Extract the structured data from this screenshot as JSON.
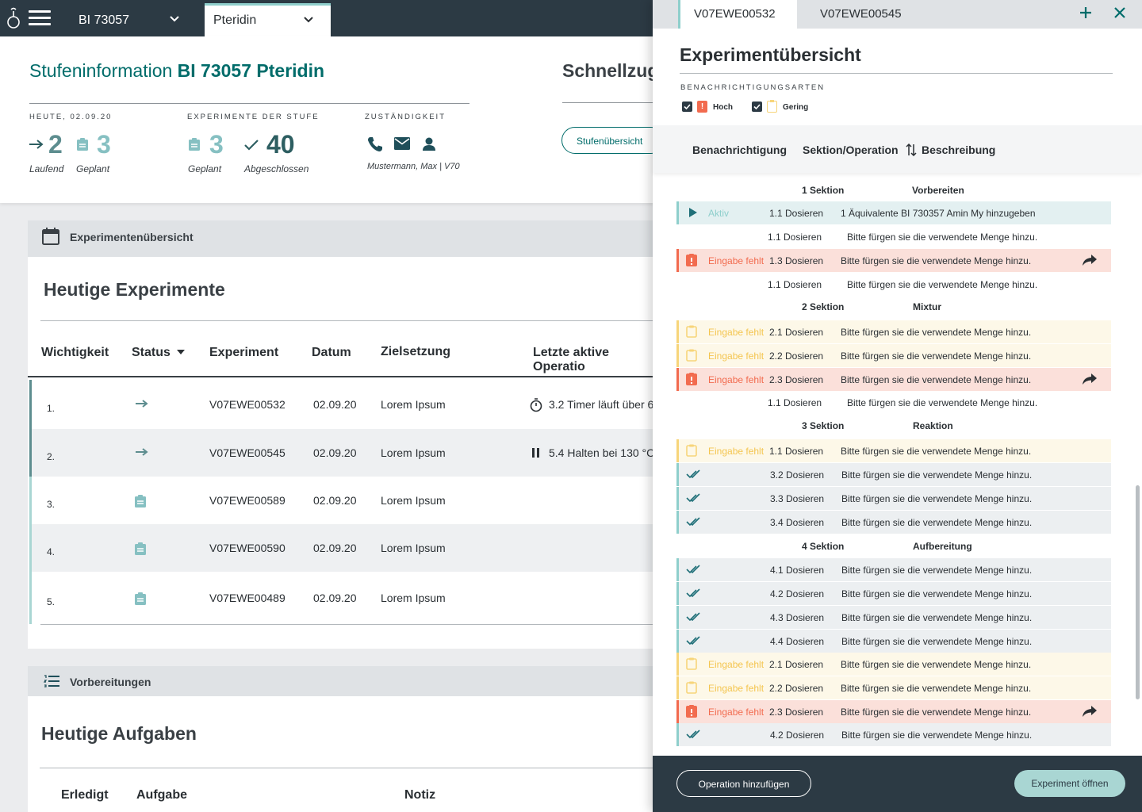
{
  "topbar": {
    "project_select": "BI 73057",
    "compound_select": "Pteridin"
  },
  "stage_info": {
    "title_prefix": "Stufeninformation",
    "title_bold": "BI 73057 Pteridin",
    "today_caption": "HEUTE, 02.09.20",
    "today_running": "2",
    "today_running_label": "Laufend",
    "today_planned": "3",
    "today_planned_label": "Geplant",
    "stage_caption": "EXPERIMENTE DER STUFE",
    "stage_planned": "3",
    "stage_planned_label": "Geplant",
    "stage_completed": "40",
    "stage_completed_label": "Abgeschlossen",
    "resp_caption": "ZUSTÄNDIGKEIT",
    "resp_person": "Mustermann, Max | V70",
    "quick_title": "Schnellzug",
    "quick_button": "Stufenübersicht"
  },
  "experiments": {
    "section_label": "Experimentenübersicht",
    "title": "Heutige Experimente",
    "columns": [
      "Wichtigkeit",
      "Status",
      "Experiment",
      "Datum",
      "Zielsetzung",
      "Letzte aktive Operatio"
    ],
    "rows": [
      {
        "idx": "1.",
        "status": "running",
        "experiment": "V07EWE00532",
        "date": "02.09.20",
        "goal": "Lorem Ipsum",
        "last_op": "3.2 Timer läuft über 6",
        "last_icon": "timer-icon"
      },
      {
        "idx": "2.",
        "status": "running",
        "experiment": "V07EWE00545",
        "date": "02.09.20",
        "goal": "Lorem Ipsum",
        "last_op": "5.4 Halten bei 130 °C",
        "last_icon": "pause-icon"
      },
      {
        "idx": "3.",
        "status": "planned",
        "experiment": "V07EWE00589",
        "date": "02.09.20",
        "goal": "Lorem Ipsum",
        "last_op": "",
        "last_icon": ""
      },
      {
        "idx": "4.",
        "status": "planned",
        "experiment": "V07EWE00590",
        "date": "02.09.20",
        "goal": "Lorem Ipsum",
        "last_op": "",
        "last_icon": ""
      },
      {
        "idx": "5.",
        "status": "planned",
        "experiment": "V07EWE00489",
        "date": "02.09.20",
        "goal": "Lorem Ipsum",
        "last_op": "",
        "last_icon": ""
      }
    ]
  },
  "preparations": {
    "section_label": "Vorbereitungen",
    "title": "Heutige Aufgaben",
    "columns": [
      "Erledigt",
      "Aufgabe",
      "Notiz"
    ]
  },
  "drawer": {
    "tabs": [
      "V07EWE00532",
      "V07EWE00545"
    ],
    "title": "Experimentübersicht",
    "notif_caption": "BENACHRICHTIGUNGSARTEN",
    "notif_high": "Hoch",
    "notif_low": "Geringe",
    "notif_low_short": "Gering",
    "columns": [
      "Benachrichtigung",
      "Sektion/Operation",
      "Beschreibung"
    ],
    "footer_add": "Operation hinzufügen",
    "footer_open": "Experiment öffnen",
    "colors": {
      "active_bg": "#e3f0f1",
      "high_bg": "#fbe0da",
      "low_bg": "#fdf8e8",
      "done_bg": "#eceff1",
      "accent": "#006c6a"
    },
    "sections": [
      {
        "name": "1 Sektion",
        "title": "Vorbereiten",
        "ops": [
          {
            "type": "active",
            "status": "Aktiv",
            "op": "1.1 Dosieren",
            "desc": "1 Äquivalente BI 730357 Amin My hinzugeben"
          },
          {
            "type": "plain",
            "status": "",
            "op": "1.1 Dosieren",
            "desc": "Bitte fürgen sie die verwendete Menge hinzu."
          },
          {
            "type": "high",
            "status": "Eingabe fehlt",
            "op": "1.3 Dosieren",
            "desc": "Bitte fürgen sie die verwendete Menge hinzu."
          },
          {
            "type": "plain",
            "status": "",
            "op": "1.1 Dosieren",
            "desc": "Bitte fürgen sie die verwendete Menge hinzu."
          }
        ]
      },
      {
        "name": "2 Sektion",
        "title": "Mixtur",
        "ops": [
          {
            "type": "low",
            "status": "Eingabe fehlt",
            "op": "2.1 Dosieren",
            "desc": "Bitte fürgen sie die verwendete Menge hinzu."
          },
          {
            "type": "low",
            "status": "Eingabe fehlt",
            "op": "2.2 Dosieren",
            "desc": "Bitte fürgen sie die verwendete Menge hinzu."
          },
          {
            "type": "high",
            "status": "Eingabe fehlt",
            "op": "2.3 Dosieren",
            "desc": "Bitte fürgen sie die verwendete Menge hinzu."
          },
          {
            "type": "plain",
            "status": "",
            "op": "1.1 Dosieren",
            "desc": "Bitte fürgen sie die verwendete Menge hinzu."
          }
        ]
      },
      {
        "name": "3 Sektion",
        "title": "Reaktion",
        "ops": [
          {
            "type": "low",
            "status": "Eingabe fehlt",
            "op": "1.1 Dosieren",
            "desc": "Bitte fürgen sie die verwendete Menge hinzu."
          },
          {
            "type": "done",
            "status": "",
            "op": "3.2 Dosieren",
            "desc": "Bitte fürgen sie die verwendete Menge hinzu."
          },
          {
            "type": "done",
            "status": "",
            "op": "3.3 Dosieren",
            "desc": "Bitte fürgen sie die verwendete Menge hinzu."
          },
          {
            "type": "done",
            "status": "",
            "op": "3.4 Dosieren",
            "desc": "Bitte fürgen sie die verwendete Menge hinzu."
          }
        ]
      },
      {
        "name": "4 Sektion",
        "title": "Aufbereitung",
        "ops": [
          {
            "type": "done",
            "status": "",
            "op": "4.1 Dosieren",
            "desc": "Bitte fürgen sie die verwendete Menge hinzu."
          },
          {
            "type": "done",
            "status": "",
            "op": "4.2 Dosieren",
            "desc": "Bitte fürgen sie die verwendete Menge hinzu."
          },
          {
            "type": "done",
            "status": "",
            "op": "4.3 Dosieren",
            "desc": "Bitte fürgen sie die verwendete Menge hinzu."
          },
          {
            "type": "done",
            "status": "",
            "op": "4.4 Dosieren",
            "desc": "Bitte fürgen sie die verwendete Menge hinzu."
          },
          {
            "type": "low",
            "status": "Eingabe fehlt",
            "op": "2.1 Dosieren",
            "desc": "Bitte fürgen sie die verwendete Menge hinzu."
          },
          {
            "type": "low",
            "status": "Eingabe fehlt",
            "op": "2.2 Dosieren",
            "desc": "Bitte fürgen sie die verwendete Menge hinzu."
          },
          {
            "type": "high",
            "status": "Eingabe fehlt",
            "op": "2.3 Dosieren",
            "desc": "Bitte fürgen sie die verwendete Menge hinzu."
          },
          {
            "type": "done",
            "status": "",
            "op": "4.2 Dosieren",
            "desc": "Bitte fürgen sie die verwendete Menge hinzu."
          }
        ]
      }
    ]
  }
}
